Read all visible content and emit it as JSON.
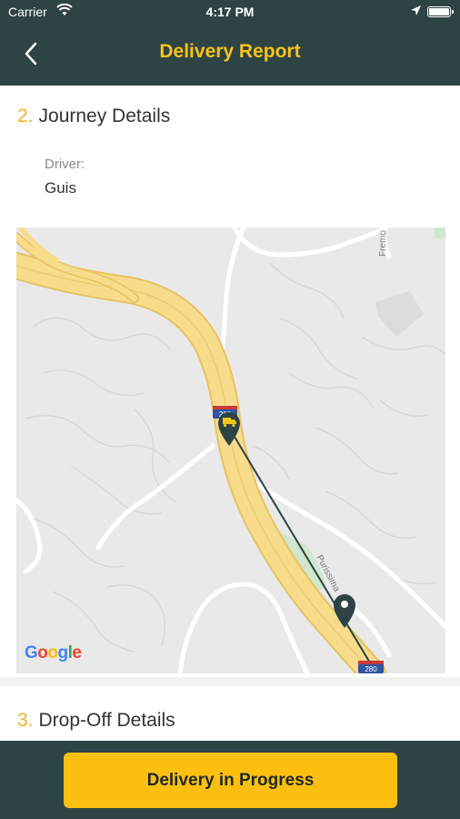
{
  "status_bar": {
    "carrier": "Carrier",
    "time": "4:17 PM"
  },
  "header": {
    "title": "Delivery Report"
  },
  "journey": {
    "number": "2.",
    "title": "Journey Details",
    "driver_label": "Driver:",
    "driver_name": "Guis"
  },
  "map": {
    "labels": {
      "fremont": "Fremo",
      "purissima": "Purissima",
      "shield_top": "280",
      "shield_bottom": "280"
    },
    "attribution": "Google"
  },
  "dropoff": {
    "number": "3.",
    "title": "Drop-Off Details"
  },
  "footer": {
    "button_label": "Delivery in Progress"
  },
  "colors": {
    "header_bg": "#2e4444",
    "accent": "#f7c21d",
    "button": "#fbbf0f",
    "highway": "#f6d77e",
    "route_line": "#2e4444"
  },
  "icons": {
    "back": "chevron-left-icon",
    "truck_pin": "truck-pin-icon",
    "destination_pin": "location-pin-icon"
  }
}
